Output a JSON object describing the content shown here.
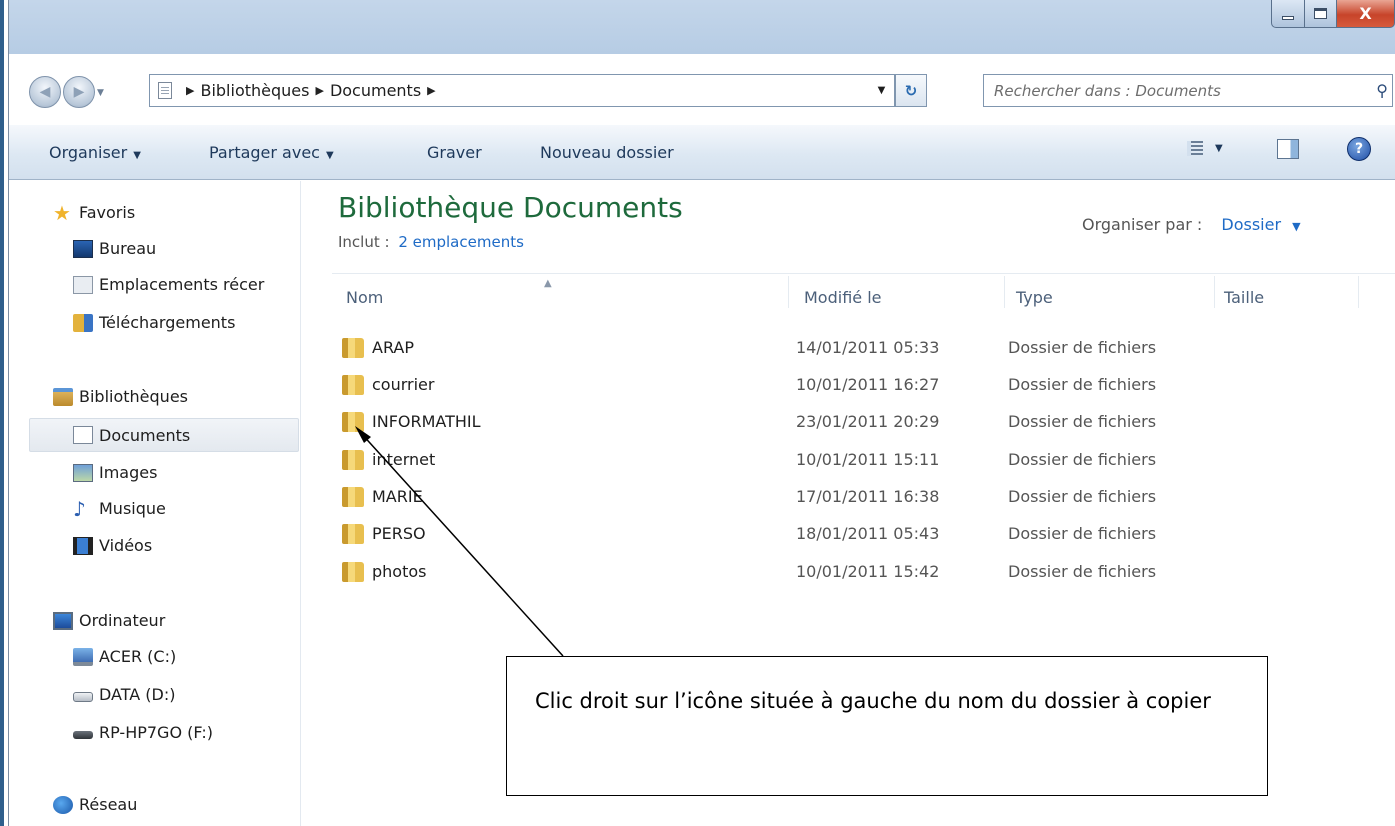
{
  "window": {
    "close_label": "X"
  },
  "address": {
    "crumbs": [
      "Bibliothèques",
      "Documents"
    ],
    "search_placeholder": "Rechercher dans : Documents"
  },
  "toolbar": {
    "organize": "Organiser",
    "share": "Partager avec",
    "burn": "Graver",
    "new_folder": "Nouveau dossier",
    "help": "?"
  },
  "sidebar": {
    "favorites": "Favoris",
    "desktop": "Bureau",
    "recent": "Emplacements récer",
    "downloads": "Téléchargements",
    "libraries": "Bibliothèques",
    "documents": "Documents",
    "images": "Images",
    "music": "Musique",
    "videos": "Vidéos",
    "computer": "Ordinateur",
    "drive_c": "ACER (C:)",
    "drive_d": "DATA (D:)",
    "drive_f": "RP-HP7GO (F:)",
    "network": "Réseau"
  },
  "main": {
    "title": "Bibliothèque Documents",
    "include_label": "Inclut :",
    "include_link": "2 emplacements",
    "arrange_label": "Organiser par :",
    "arrange_value": "Dossier",
    "columns": {
      "name": "Nom",
      "modified": "Modifié le",
      "type": "Type",
      "size": "Taille"
    },
    "files": [
      {
        "name": "ARAP",
        "modified": "14/01/2011 05:33",
        "type": "Dossier de fichiers"
      },
      {
        "name": "courrier",
        "modified": "10/01/2011 16:27",
        "type": "Dossier de fichiers"
      },
      {
        "name": "INFORMATHIL",
        "modified": "23/01/2011 20:29",
        "type": "Dossier de fichiers"
      },
      {
        "name": "internet",
        "modified": "10/01/2011 15:11",
        "type": "Dossier de fichiers"
      },
      {
        "name": "MARIE",
        "modified": "17/01/2011 16:38",
        "type": "Dossier de fichiers"
      },
      {
        "name": "PERSO",
        "modified": "18/01/2011 05:43",
        "type": "Dossier de fichiers"
      },
      {
        "name": "photos",
        "modified": "10/01/2011 15:42",
        "type": "Dossier de fichiers"
      }
    ]
  },
  "annotation": {
    "text": "Clic droit sur l’icône située à gauche du nom du dossier à copier"
  }
}
